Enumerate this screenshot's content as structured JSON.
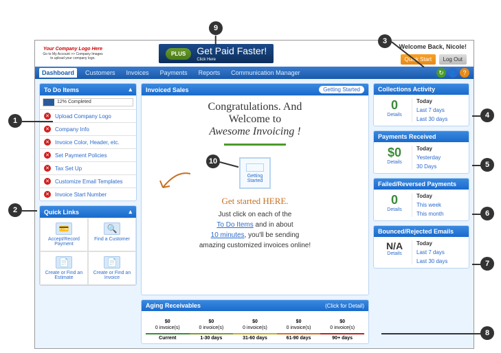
{
  "header": {
    "logo_title": "Your Company Logo Here",
    "logo_sub": "Go to My Account >> Company Images to upload your company logo.",
    "plus_badge": "PLUS",
    "banner_text": "Get Paid Faster!",
    "banner_sub": "Click Here",
    "welcome": "Welcome Back, Nicole!",
    "quick_start": "Quick Start",
    "log_out": "Log Out"
  },
  "nav": {
    "items": [
      "Dashboard",
      "Customers",
      "Invoices",
      "Payments",
      "Reports",
      "Communication Manager"
    ]
  },
  "todo": {
    "title": "To Do Items",
    "progress_text": "12% Completed",
    "items": [
      {
        "label": "Upload Company Logo"
      },
      {
        "label": "Company Info"
      },
      {
        "label": "Invoice Color, Header, etc."
      },
      {
        "label": "Set Payment Policies"
      },
      {
        "label": "Tax Set Up"
      },
      {
        "label": "Customize Email Templates"
      },
      {
        "label": "Invoice Start Number"
      }
    ]
  },
  "quicklinks": {
    "title": "Quick Links",
    "items": [
      {
        "label": "Accept/Record Payment"
      },
      {
        "label": "Find a Customer"
      },
      {
        "label": "Create or Find an Estimate"
      },
      {
        "label": "Create or Find an Invoice"
      }
    ]
  },
  "mid": {
    "invoiced_sales": "Invoiced Sales",
    "getting_started_tab": "Getting Started",
    "congrats_l1": "Congratulations. And",
    "congrats_l2": "Welcome to",
    "congrats_l3": "Awesome Invoicing !",
    "gs_box": "Getting Started",
    "get_started_here": "Get started HERE.",
    "instr_1": "Just click on each of the",
    "instr_link1": "To Do Items",
    "instr_2": " and in about",
    "instr_link2": "10 minutes",
    "instr_3": ", you'll be sending",
    "instr_4": "amazing customized invoices online!",
    "aging_title": "Aging Receivables",
    "aging_hint": "(Click for Detail)"
  },
  "aging": {
    "cols": [
      {
        "val": "$0",
        "inv": "0 invoice(s)",
        "label": "Current"
      },
      {
        "val": "$0",
        "inv": "0 invoice(s)",
        "label": "1-30 days"
      },
      {
        "val": "$0",
        "inv": "0 invoice(s)",
        "label": "31-60 days"
      },
      {
        "val": "$0",
        "inv": "0 invoice(s)",
        "label": "61-90 days"
      },
      {
        "val": "$0",
        "inv": "0 invoice(s)",
        "label": "90+ days"
      }
    ]
  },
  "stats": [
    {
      "title": "Collections Activity",
      "num": "0",
      "details": "Details",
      "r1": "Today",
      "r2": "Last 7 days",
      "r3": "Last 30 days"
    },
    {
      "title": "Payments Received",
      "num": "$0",
      "details": "Details",
      "r1": "Today",
      "r2": "Yesterday",
      "r3": "30 Days"
    },
    {
      "title": "Failed/Reversed Payments",
      "num": "0",
      "details": "Details",
      "r1": "Today",
      "r2": "This week",
      "r3": "This month"
    },
    {
      "title": "Bounced/Rejected Emails",
      "num": "N/A",
      "details": "Details",
      "r1": "Today",
      "r2": "Last 7 days",
      "r3": "Last 30 days"
    }
  ],
  "callouts": [
    "1",
    "2",
    "3",
    "4",
    "5",
    "6",
    "7",
    "8",
    "9",
    "10"
  ]
}
